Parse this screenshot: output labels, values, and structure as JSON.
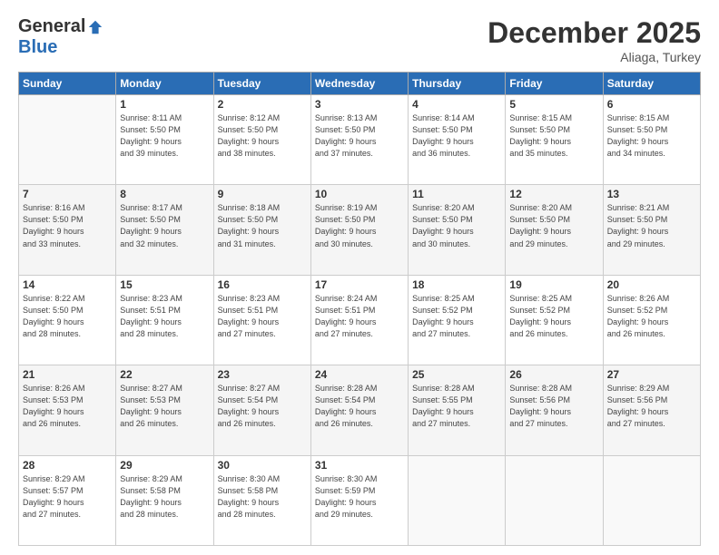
{
  "logo": {
    "general": "General",
    "blue": "Blue"
  },
  "header": {
    "month_year": "December 2025",
    "location": "Aliaga, Turkey"
  },
  "days_of_week": [
    "Sunday",
    "Monday",
    "Tuesday",
    "Wednesday",
    "Thursday",
    "Friday",
    "Saturday"
  ],
  "weeks": [
    [
      {
        "day": "",
        "info": ""
      },
      {
        "day": "1",
        "info": "Sunrise: 8:11 AM\nSunset: 5:50 PM\nDaylight: 9 hours\nand 39 minutes."
      },
      {
        "day": "2",
        "info": "Sunrise: 8:12 AM\nSunset: 5:50 PM\nDaylight: 9 hours\nand 38 minutes."
      },
      {
        "day": "3",
        "info": "Sunrise: 8:13 AM\nSunset: 5:50 PM\nDaylight: 9 hours\nand 37 minutes."
      },
      {
        "day": "4",
        "info": "Sunrise: 8:14 AM\nSunset: 5:50 PM\nDaylight: 9 hours\nand 36 minutes."
      },
      {
        "day": "5",
        "info": "Sunrise: 8:15 AM\nSunset: 5:50 PM\nDaylight: 9 hours\nand 35 minutes."
      },
      {
        "day": "6",
        "info": "Sunrise: 8:15 AM\nSunset: 5:50 PM\nDaylight: 9 hours\nand 34 minutes."
      }
    ],
    [
      {
        "day": "7",
        "info": "Sunrise: 8:16 AM\nSunset: 5:50 PM\nDaylight: 9 hours\nand 33 minutes."
      },
      {
        "day": "8",
        "info": "Sunrise: 8:17 AM\nSunset: 5:50 PM\nDaylight: 9 hours\nand 32 minutes."
      },
      {
        "day": "9",
        "info": "Sunrise: 8:18 AM\nSunset: 5:50 PM\nDaylight: 9 hours\nand 31 minutes."
      },
      {
        "day": "10",
        "info": "Sunrise: 8:19 AM\nSunset: 5:50 PM\nDaylight: 9 hours\nand 30 minutes."
      },
      {
        "day": "11",
        "info": "Sunrise: 8:20 AM\nSunset: 5:50 PM\nDaylight: 9 hours\nand 30 minutes."
      },
      {
        "day": "12",
        "info": "Sunrise: 8:20 AM\nSunset: 5:50 PM\nDaylight: 9 hours\nand 29 minutes."
      },
      {
        "day": "13",
        "info": "Sunrise: 8:21 AM\nSunset: 5:50 PM\nDaylight: 9 hours\nand 29 minutes."
      }
    ],
    [
      {
        "day": "14",
        "info": "Sunrise: 8:22 AM\nSunset: 5:50 PM\nDaylight: 9 hours\nand 28 minutes."
      },
      {
        "day": "15",
        "info": "Sunrise: 8:23 AM\nSunset: 5:51 PM\nDaylight: 9 hours\nand 28 minutes."
      },
      {
        "day": "16",
        "info": "Sunrise: 8:23 AM\nSunset: 5:51 PM\nDaylight: 9 hours\nand 27 minutes."
      },
      {
        "day": "17",
        "info": "Sunrise: 8:24 AM\nSunset: 5:51 PM\nDaylight: 9 hours\nand 27 minutes."
      },
      {
        "day": "18",
        "info": "Sunrise: 8:25 AM\nSunset: 5:52 PM\nDaylight: 9 hours\nand 27 minutes."
      },
      {
        "day": "19",
        "info": "Sunrise: 8:25 AM\nSunset: 5:52 PM\nDaylight: 9 hours\nand 26 minutes."
      },
      {
        "day": "20",
        "info": "Sunrise: 8:26 AM\nSunset: 5:52 PM\nDaylight: 9 hours\nand 26 minutes."
      }
    ],
    [
      {
        "day": "21",
        "info": "Sunrise: 8:26 AM\nSunset: 5:53 PM\nDaylight: 9 hours\nand 26 minutes."
      },
      {
        "day": "22",
        "info": "Sunrise: 8:27 AM\nSunset: 5:53 PM\nDaylight: 9 hours\nand 26 minutes."
      },
      {
        "day": "23",
        "info": "Sunrise: 8:27 AM\nSunset: 5:54 PM\nDaylight: 9 hours\nand 26 minutes."
      },
      {
        "day": "24",
        "info": "Sunrise: 8:28 AM\nSunset: 5:54 PM\nDaylight: 9 hours\nand 26 minutes."
      },
      {
        "day": "25",
        "info": "Sunrise: 8:28 AM\nSunset: 5:55 PM\nDaylight: 9 hours\nand 27 minutes."
      },
      {
        "day": "26",
        "info": "Sunrise: 8:28 AM\nSunset: 5:56 PM\nDaylight: 9 hours\nand 27 minutes."
      },
      {
        "day": "27",
        "info": "Sunrise: 8:29 AM\nSunset: 5:56 PM\nDaylight: 9 hours\nand 27 minutes."
      }
    ],
    [
      {
        "day": "28",
        "info": "Sunrise: 8:29 AM\nSunset: 5:57 PM\nDaylight: 9 hours\nand 27 minutes."
      },
      {
        "day": "29",
        "info": "Sunrise: 8:29 AM\nSunset: 5:58 PM\nDaylight: 9 hours\nand 28 minutes."
      },
      {
        "day": "30",
        "info": "Sunrise: 8:30 AM\nSunset: 5:58 PM\nDaylight: 9 hours\nand 28 minutes."
      },
      {
        "day": "31",
        "info": "Sunrise: 8:30 AM\nSunset: 5:59 PM\nDaylight: 9 hours\nand 29 minutes."
      },
      {
        "day": "",
        "info": ""
      },
      {
        "day": "",
        "info": ""
      },
      {
        "day": "",
        "info": ""
      }
    ]
  ]
}
